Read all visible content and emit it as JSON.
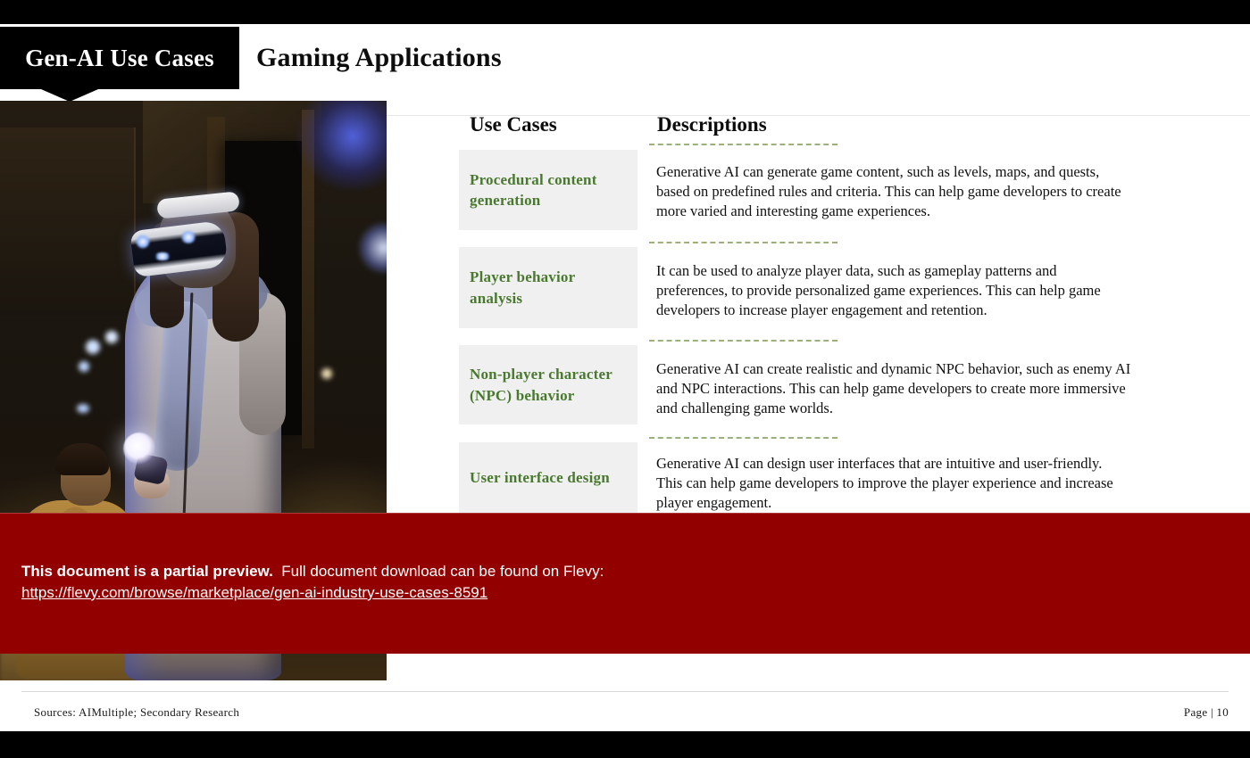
{
  "header": {
    "tab_label": "Gen-AI Use Cases",
    "title": "Gaming Applications"
  },
  "table": {
    "columns": {
      "use_cases": "Use Cases",
      "descriptions": "Descriptions"
    },
    "rows": [
      {
        "use_case": "Procedural content generation",
        "description": "Generative AI can generate game content, such as levels, maps, and quests, based on predefined rules and criteria. This can help game developers to create more varied and interesting game experiences."
      },
      {
        "use_case": "Player behavior analysis",
        "description": "It can be used to analyze player data, such as gameplay patterns and preferences, to provide personalized game experiences. This can help game developers to increase player engagement and retention."
      },
      {
        "use_case": "Non-player character (NPC) behavior",
        "description": "Generative AI can create realistic and dynamic NPC behavior, such as enemy AI and NPC interactions. This can help game developers to create more immersive and challenging game worlds."
      },
      {
        "use_case": "User interface design",
        "description": "Generative AI can design user interfaces that are intuitive and user-friendly. This can help game developers to improve the player experience and increase player engagement."
      }
    ]
  },
  "banner": {
    "headline": "This document is a partial preview.",
    "subtext": "Full document download can be found on Flevy:",
    "link": "https://flevy.com/browse/marketplace/gen-ai-industry-use-cases-8591",
    "background_color": "#920000"
  },
  "footer": {
    "sources": "Sources: AIMultiple; Secondary Research",
    "page": "Page | 10"
  },
  "photo": {
    "alt": "Woman wearing a VR headset holding a glowing motion controller in a dim room, man seated in background"
  },
  "colors": {
    "accent_green": "#49792f",
    "cell_background": "#f0f0f0",
    "dash_line": "#9bb07a",
    "bar_black": "#000000",
    "banner_red": "#920000"
  }
}
